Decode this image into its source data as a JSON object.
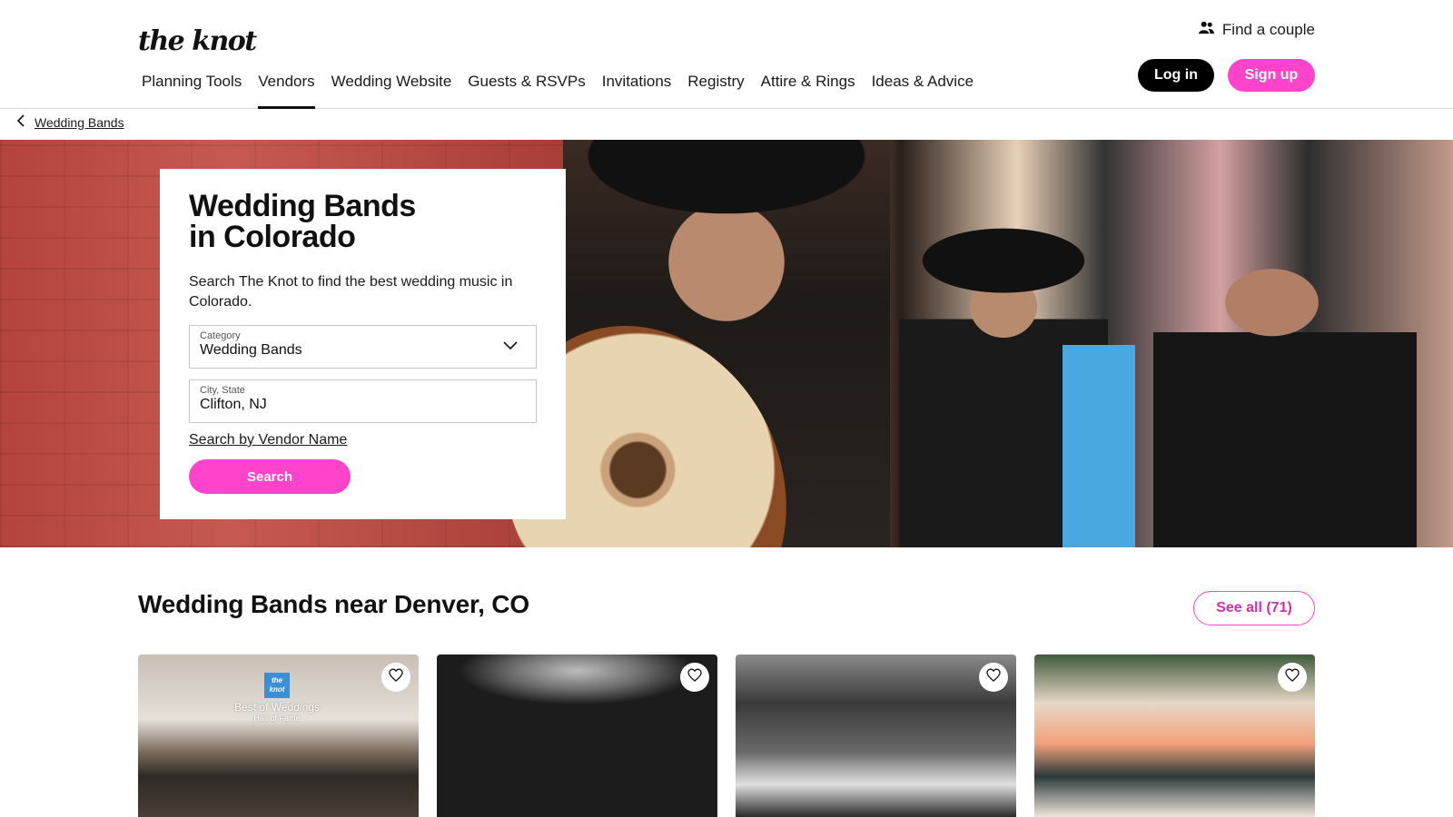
{
  "header": {
    "logo": "the knot",
    "find_couple": "Find a couple",
    "login": "Log in",
    "signup": "Sign up",
    "nav": [
      {
        "label": "Planning Tools",
        "active": false
      },
      {
        "label": "Vendors",
        "active": true
      },
      {
        "label": "Wedding Website",
        "active": false
      },
      {
        "label": "Guests & RSVPs",
        "active": false
      },
      {
        "label": "Invitations",
        "active": false
      },
      {
        "label": "Registry",
        "active": false
      },
      {
        "label": "Attire & Rings",
        "active": false
      },
      {
        "label": "Ideas & Advice",
        "active": false
      }
    ]
  },
  "breadcrumb": {
    "label": "Wedding Bands"
  },
  "search": {
    "title_line1": "Wedding Bands",
    "title_line2": "in Colorado",
    "description": "Search The Knot to find the best wedding music in Colorado.",
    "category_label": "Category",
    "category_value": "Wedding Bands",
    "city_label": "City, State",
    "city_value": "Clifton, NJ",
    "vendor_link": "Search by Vendor Name",
    "button": "Search"
  },
  "section": {
    "title": "Wedding Bands near Denver, CO",
    "see_all": "See all (71)"
  },
  "cards": [
    {
      "badge_logo": "the knot",
      "badge_title": "Best of Weddings",
      "badge_sub": "Hall of Fame"
    },
    {},
    {},
    {}
  ],
  "colors": {
    "accent_pink": "#ff44cb",
    "black": "#000000"
  }
}
